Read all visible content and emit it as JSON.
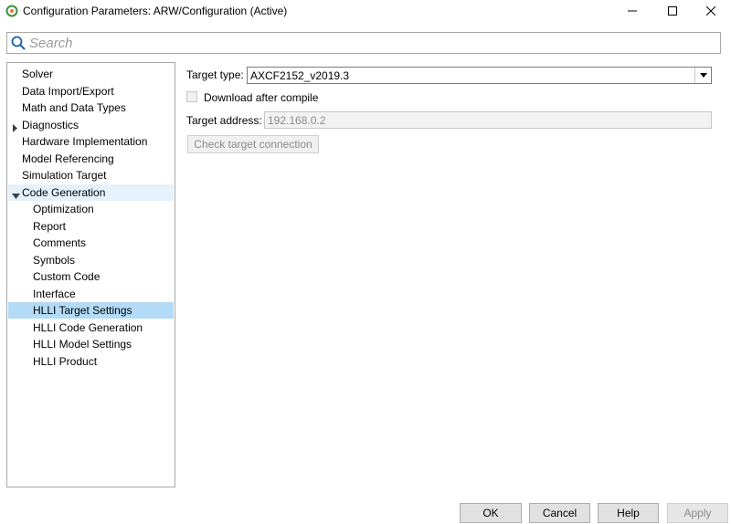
{
  "window": {
    "title": "Configuration Parameters: ARW/Configuration (Active)",
    "app_icon": "simulink-gear-icon"
  },
  "search": {
    "placeholder": "Search",
    "value": ""
  },
  "tree": {
    "items": [
      {
        "label": "Solver",
        "level": 0,
        "state": "normal"
      },
      {
        "label": "Data Import/Export",
        "level": 0,
        "state": "normal"
      },
      {
        "label": "Math and Data Types",
        "level": 0,
        "state": "normal"
      },
      {
        "label": "Diagnostics",
        "level": 0,
        "state": "collapsed"
      },
      {
        "label": "Hardware Implementation",
        "level": 0,
        "state": "normal"
      },
      {
        "label": "Model Referencing",
        "level": 0,
        "state": "normal"
      },
      {
        "label": "Simulation Target",
        "level": 0,
        "state": "normal"
      },
      {
        "label": "Code Generation",
        "level": 0,
        "state": "expanded"
      },
      {
        "label": "Optimization",
        "level": 1,
        "state": "normal"
      },
      {
        "label": "Report",
        "level": 1,
        "state": "normal"
      },
      {
        "label": "Comments",
        "level": 1,
        "state": "normal"
      },
      {
        "label": "Symbols",
        "level": 1,
        "state": "normal"
      },
      {
        "label": "Custom Code",
        "level": 1,
        "state": "normal"
      },
      {
        "label": "Interface",
        "level": 1,
        "state": "normal"
      },
      {
        "label": "HLLI Target Settings",
        "level": 1,
        "state": "selected"
      },
      {
        "label": "HLLI Code Generation",
        "level": 1,
        "state": "normal"
      },
      {
        "label": "HLLI Model Settings",
        "level": 1,
        "state": "normal"
      },
      {
        "label": "HLLI Product",
        "level": 1,
        "state": "normal"
      }
    ]
  },
  "settings": {
    "target_type_label": "Target type:",
    "target_type_value": "AXCF2152_v2019.3",
    "download_label": "Download after compile",
    "download_checked": false,
    "target_address_label": "Target address:",
    "target_address_value": "192.168.0.2",
    "check_connection_label": "Check target connection"
  },
  "buttons": {
    "ok": "OK",
    "cancel": "Cancel",
    "help": "Help",
    "apply": "Apply"
  },
  "colors": {
    "selected_bg": "#b3dbf8",
    "highlight_bg": "#e5f1fb"
  }
}
